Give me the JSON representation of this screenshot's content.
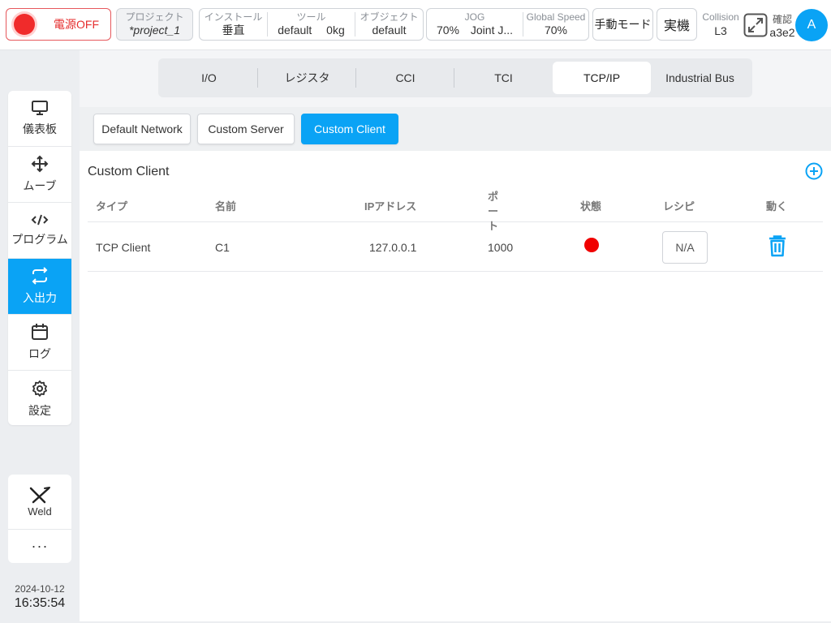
{
  "topbar": {
    "power_label": "電源OFF",
    "project": {
      "label": "プロジェクト",
      "value": "*project_1"
    },
    "install": {
      "install_label": "インストール",
      "install_value": "垂直",
      "tool_label": "ツール",
      "tool_value": "default",
      "tool_weight": "0kg",
      "object_label": "オブジェクト",
      "object_value": "default"
    },
    "jog": {
      "jog_label": "JOG",
      "jog_speed": "70%",
      "jog_mode": "Joint J...",
      "global_label": "Global Speed",
      "global_value": "70%"
    },
    "mode_label": "手動モード",
    "real_label": "実機",
    "collision_label": "Collision",
    "collision_value": "L3",
    "confirm_label": "確認",
    "confirm_value": "a3e2",
    "avatar_letter": "A"
  },
  "nav": {
    "items": [
      {
        "label": "儀表板",
        "icon": "monitor-icon"
      },
      {
        "label": "ムーブ",
        "icon": "move-arrows-icon"
      },
      {
        "label": "プログラム",
        "icon": "code-icon"
      },
      {
        "label": "入出力",
        "icon": "swap-icon"
      },
      {
        "label": "ログ",
        "icon": "calendar-icon"
      },
      {
        "label": "設定",
        "icon": "gear-icon"
      }
    ],
    "active_index": 3,
    "weld_label": "Weld",
    "more_label": "···"
  },
  "datetime": {
    "date": "2024-10-12",
    "time": "16:35:54"
  },
  "tabs": [
    {
      "label": "I/O"
    },
    {
      "label": "レジスタ"
    },
    {
      "label": "CCI"
    },
    {
      "label": "TCI"
    },
    {
      "label": "TCP/IP"
    },
    {
      "label": "Industrial Bus"
    }
  ],
  "active_tab": "TCP/IP",
  "subtabs": [
    {
      "label": "Default Network"
    },
    {
      "label": "Custom Server"
    },
    {
      "label": "Custom Client"
    }
  ],
  "active_subtab": "Custom Client",
  "section_title": "Custom Client",
  "table": {
    "headers": {
      "type": "タイプ",
      "name": "名前",
      "ip": "IPアドレス",
      "port": "ポート",
      "status": "状態",
      "recipe": "レシピ",
      "action": "動く"
    },
    "rows": [
      {
        "type": "TCP Client",
        "name": "C1",
        "ip": "127.0.0.1",
        "port": "1000",
        "status_color": "#f00000",
        "recipe": "N/A"
      }
    ]
  },
  "colors": {
    "accent": "#0aa3f5",
    "power_red": "#f02b2b",
    "status_red": "#f00000"
  }
}
